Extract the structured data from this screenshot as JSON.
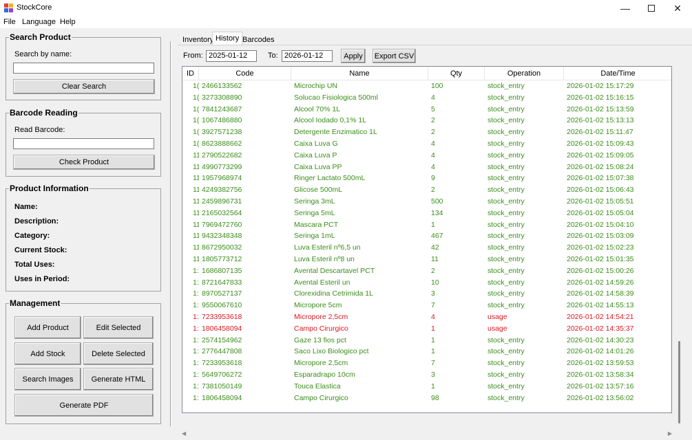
{
  "app": {
    "title": "StockCore"
  },
  "menu": [
    "File",
    "Language",
    "Help"
  ],
  "search": {
    "title": "Search Product",
    "label": "Search by name:",
    "value": "",
    "clear_label": "Clear Search"
  },
  "barcode": {
    "title": "Barcode Reading",
    "label": "Read Barcode:",
    "value": "",
    "check_label": "Check Product"
  },
  "info": {
    "title": "Product Information",
    "fields": [
      "Name:",
      "Description:",
      "Category:",
      "Current Stock:",
      "Total Uses:",
      "Uses in Period:"
    ]
  },
  "management": {
    "title": "Management",
    "add_product": "Add Product",
    "edit_selected": "Edit Selected",
    "add_stock": "Add Stock",
    "delete_selected": "Delete Selected",
    "search_images": "Search Images",
    "generate_html": "Generate HTML",
    "generate_pdf": "Generate PDF"
  },
  "tabs": [
    "Inventory",
    "History",
    "Barcodes"
  ],
  "filter": {
    "from_label": "From:",
    "from_value": "2025-01-12",
    "to_label": "To:",
    "to_value": "2026-01-12",
    "apply_label": "Apply",
    "export_label": "Export CSV"
  },
  "table": {
    "columns": [
      "ID",
      "Code",
      "Name",
      "Qty",
      "Operation",
      "Date/Time"
    ],
    "rows": [
      [
        "1(",
        "2466133562",
        "Microchip UN",
        "100",
        "stock_entry",
        "2026-01-02 15:17:29"
      ],
      [
        "1(",
        "3273308890",
        "Solucao Fisiologica 500ml",
        "4",
        "stock_entry",
        "2026-01-02 15:16:15"
      ],
      [
        "1(",
        "7841243687",
        "Alcool 70% 1L",
        "5",
        "stock_entry",
        "2026-01-02 15:13:59"
      ],
      [
        "1(",
        "1067486880",
        "Alcool Iodado 0,1% 1L",
        "2",
        "stock_entry",
        "2026-01-02 15:13:13"
      ],
      [
        "1(",
        "3927571238",
        "Detergente Enzimatico 1L",
        "2",
        "stock_entry",
        "2026-01-02 15:11:47"
      ],
      [
        "1(",
        "8623888662",
        "Caixa Luva G",
        "4",
        "stock_entry",
        "2026-01-02 15:09:43"
      ],
      [
        "11",
        "2790522682",
        "Caixa Luva P",
        "4",
        "stock_entry",
        "2026-01-02 15:09:05"
      ],
      [
        "11",
        "4990773299",
        "Caixa Luva PP",
        "4",
        "stock_entry",
        "2026-01-02 15:08:24"
      ],
      [
        "11",
        "1957968974",
        "Ringer Lactato 500mL",
        "9",
        "stock_entry",
        "2026-01-02 15:07:38"
      ],
      [
        "11",
        "4249382756",
        "Glicose 500mL",
        "2",
        "stock_entry",
        "2026-01-02 15:06:43"
      ],
      [
        "11",
        "2459896731",
        "Seringa 3mL",
        "500",
        "stock_entry",
        "2026-01-02 15:05:51"
      ],
      [
        "11",
        "2165032564",
        "Seringa 5mL",
        "134",
        "stock_entry",
        "2026-01-02 15:05:04"
      ],
      [
        "11",
        "7969472760",
        "Mascara PCT",
        "1",
        "stock_entry",
        "2026-01-02 15:04:10"
      ],
      [
        "11",
        "9432348348",
        "Seringa 1mL",
        "467",
        "stock_entry",
        "2026-01-02 15:03:09"
      ],
      [
        "11",
        "8672950032",
        "Luva Esteril nº6,5 un",
        "42",
        "stock_entry",
        "2026-01-02 15:02:23"
      ],
      [
        "11",
        "1805773712",
        "Luva Esteril nº8 un",
        "11",
        "stock_entry",
        "2026-01-02 15:01:35"
      ],
      [
        "1:",
        "1686807135",
        "Avental Descartavel PCT",
        "2",
        "stock_entry",
        "2026-01-02 15:00:26"
      ],
      [
        "1:",
        "8721647833",
        "Avental Esteril un",
        "10",
        "stock_entry",
        "2026-01-02 14:59:26"
      ],
      [
        "1:",
        "8970527137",
        "Clorexidina Cetrimida 1L",
        "3",
        "stock_entry",
        "2026-01-02 14:58:39"
      ],
      [
        "1:",
        "9550067610",
        "Micropore 5cm",
        "7",
        "stock_entry",
        "2026-01-02 14:55:13"
      ],
      [
        "1:",
        "7233953618",
        "Micropore 2,5cm",
        "4",
        "usage",
        "2026-01-02 14:54:21"
      ],
      [
        "1:",
        "1806458094",
        "Campo Cirurgico",
        "1",
        "usage",
        "2026-01-02 14:35:37"
      ],
      [
        "1:",
        "2574154962",
        "Gaze 13 fios pct",
        "1",
        "stock_entry",
        "2026-01-02 14:30:23"
      ],
      [
        "1:",
        "2776447808",
        "Saco Lixo Biologico pct",
        "1",
        "stock_entry",
        "2026-01-02 14:01:26"
      ],
      [
        "1:",
        "7233953618",
        "Micropore 2,5cm",
        "7",
        "stock_entry",
        "2026-01-02 13:59:53"
      ],
      [
        "1:",
        "5649706272",
        "Esparadrapo 10cm",
        "3",
        "stock_entry",
        "2026-01-02 13:58:34"
      ],
      [
        "1:",
        "7381050149",
        "Touca Elastica",
        "1",
        "stock_entry",
        "2026-01-02 13:57:16"
      ],
      [
        "1:",
        "1806458094",
        "Campo Cirurgico",
        "98",
        "stock_entry",
        "2026-01-02 13:56:02"
      ]
    ]
  },
  "colors": {
    "stock_entry": "#3a8d1a",
    "usage": "#e0161e"
  }
}
